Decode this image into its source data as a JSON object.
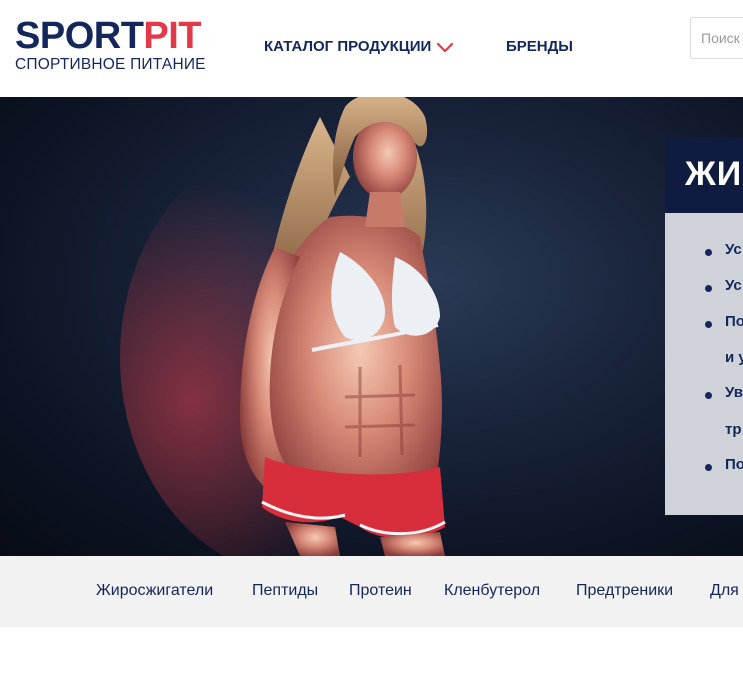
{
  "brand": {
    "logo_part1": "SPORT",
    "logo_part2": "PIT",
    "tagline": "СПОРТИВНОЕ ПИТАНИЕ",
    "colors": {
      "navy": "#14275a",
      "red": "#e23a4a"
    }
  },
  "nav": {
    "catalog_label": "КАТАЛОГ ПРОДУКЦИИ",
    "catalog_icon": "chevron-down-icon",
    "brands_label": "БРЕНДЫ"
  },
  "search": {
    "placeholder": "Поиск",
    "value": ""
  },
  "hero": {
    "promo_title": "ЖИ",
    "promo_items": [
      "Ус",
      "Ус",
      "По",
      "и у",
      "Ув",
      "тр",
      "По"
    ]
  },
  "categories": [
    "Жиросжигатели",
    "Пептиды",
    "Протеин",
    "Кленбутерол",
    "Предтреники",
    "Для"
  ]
}
